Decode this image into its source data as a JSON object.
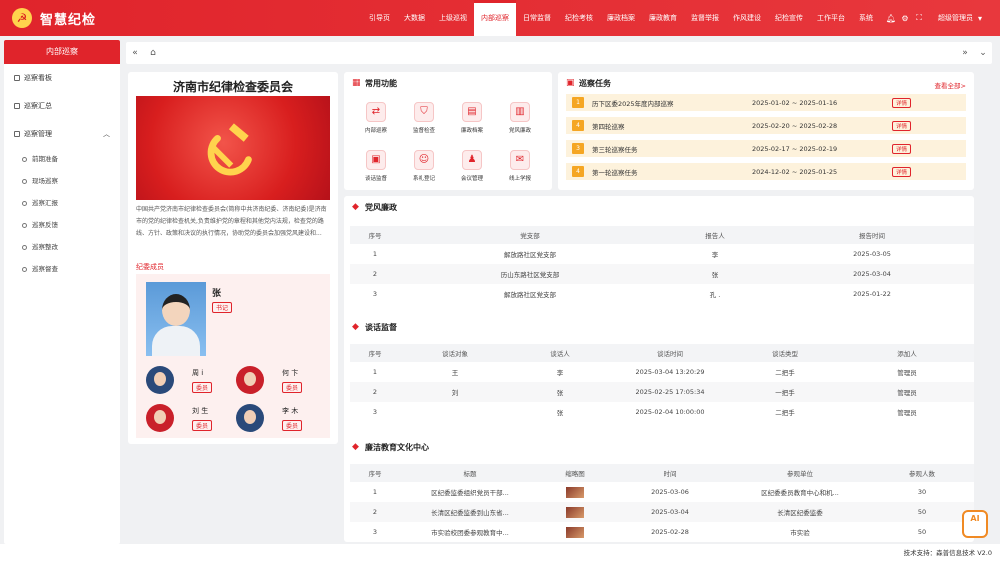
{
  "header": {
    "title": "智慧纪检",
    "nav": [
      {
        "label": "引导页"
      },
      {
        "label": "大数据"
      },
      {
        "label": "上级巡视"
      },
      {
        "label": "内部巡察",
        "active": true
      },
      {
        "label": "日常监督"
      },
      {
        "label": "纪检考核"
      },
      {
        "label": "廉政档案"
      },
      {
        "label": "廉政教育"
      },
      {
        "label": "监督举报"
      },
      {
        "label": "作风建设"
      },
      {
        "label": "纪检宣传"
      },
      {
        "label": "工作平台"
      },
      {
        "label": "系统"
      }
    ],
    "user": "超级管理员",
    "accent": "#e0242b"
  },
  "sidebar": {
    "title": "内部巡察",
    "items": [
      {
        "label": "巡察看板"
      },
      {
        "label": "巡察汇总"
      },
      {
        "label": "巡察管理"
      }
    ],
    "sub_items": [
      {
        "label": "前期准备"
      },
      {
        "label": "现场巡察"
      },
      {
        "label": "巡察汇报"
      },
      {
        "label": "巡察反馈"
      },
      {
        "label": "巡察整改"
      },
      {
        "label": "巡察督查"
      }
    ]
  },
  "org": {
    "title": "济南市纪律检查委员会",
    "description": "中国共产党济南市纪律检查委员会(简称中共济南纪委、济南纪委)是济南市的党的纪律检查机关,负责维护党的章程和其他党内法规，检查党的路线、方针、政策和决议的执行情况，协助党的委员会加强党风建设和...",
    "members_title": "纪委成员",
    "leader": {
      "name": "张",
      "role": "书记"
    },
    "members": [
      {
        "name": "周  i",
        "role": "委员"
      },
      {
        "name": "何  卞",
        "role": "委员"
      },
      {
        "name": "刘  生",
        "role": "委员"
      },
      {
        "name": "李  木",
        "role": "委员"
      }
    ]
  },
  "quick": {
    "title": "常用功能",
    "items": [
      {
        "label": "内部巡察",
        "icon": "exchange-icon"
      },
      {
        "label": "监督检查",
        "icon": "shield-icon"
      },
      {
        "label": "廉政档案",
        "icon": "archive-icon"
      },
      {
        "label": "党风廉政",
        "icon": "document-icon"
      },
      {
        "label": "谈话监督",
        "icon": "chat-icon"
      },
      {
        "label": "系礼登记",
        "icon": "user-register-icon"
      },
      {
        "label": "会议管理",
        "icon": "meeting-icon"
      },
      {
        "label": "线上学报",
        "icon": "report-icon"
      }
    ]
  },
  "tasks": {
    "title": "巡察任务",
    "view_all": "查看全部>",
    "items": [
      {
        "num": "1",
        "name": "历下区委2025年度内部巡察",
        "date": "2025-01-02 ~ 2025-01-16",
        "btn": "详情"
      },
      {
        "num": "4",
        "name": "第四轮巡察",
        "date": "2025-02-20 ~ 2025-02-28",
        "btn": "详情"
      },
      {
        "num": "3",
        "name": "第三轮巡察任务",
        "date": "2025-02-17 ~ 2025-02-19",
        "btn": "详情"
      },
      {
        "num": "4",
        "name": "第一轮巡察任务",
        "date": "2024-12-02 ~ 2025-01-25",
        "btn": "详情"
      }
    ]
  },
  "party": {
    "title": "党风廉政",
    "headers": [
      "序号",
      "党支部",
      "报告人",
      "报告时间"
    ],
    "rows": [
      [
        "1",
        "解放路社区党支部",
        "李",
        "2025-03-05"
      ],
      [
        "2",
        "历山东路社区党支部",
        "张",
        "2025-03-04"
      ],
      [
        "3",
        "解放路社区党支部",
        "孔 .",
        "2025-01-22"
      ]
    ]
  },
  "talk": {
    "title": "谈话监督",
    "headers": [
      "序号",
      "谈话对象",
      "谈话人",
      "谈话时间",
      "谈话类型",
      "添加人"
    ],
    "rows": [
      [
        "1",
        "王",
        "李",
        "2025-03-04 13:20:29",
        "二把手",
        "管理员"
      ],
      [
        "2",
        "刘",
        "张",
        "2025-02-25 17:05:34",
        "一把手",
        "管理员"
      ],
      [
        "3",
        "",
        "张",
        "2025-02-04 10:00:00",
        "二把手",
        "管理员"
      ]
    ]
  },
  "culture": {
    "title": "廉洁教育文化中心",
    "headers": [
      "序号",
      "标题",
      "缩略图",
      "时间",
      "参观单位",
      "参观人数"
    ],
    "rows": [
      [
        "1",
        "区纪委监委组织党员干部...",
        "",
        "2025-03-06",
        "区纪委委员教育中心和机...",
        "30"
      ],
      [
        "2",
        "长清区纪委监委到山东省...",
        "",
        "2025-03-04",
        "长清区纪委监委",
        "50"
      ],
      [
        "3",
        "市实验校团委参观教育中...",
        "",
        "2025-02-28",
        "市实验",
        "50"
      ]
    ]
  },
  "footer": {
    "text": "技术支持：森普信息技术 V2.0"
  },
  "ai": {
    "label": "AI"
  }
}
